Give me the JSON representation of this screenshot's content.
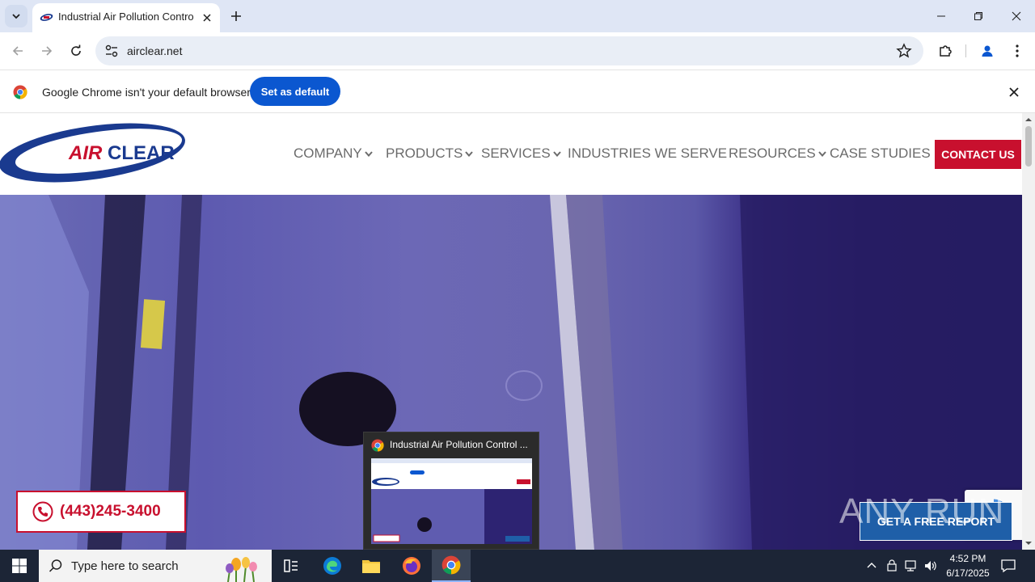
{
  "browser": {
    "tab": {
      "title": "Industrial Air Pollution Control S"
    },
    "address_bar": {
      "url": "airclear.net"
    },
    "infobar": {
      "message": "Google Chrome isn't your default browser",
      "button": "Set as default"
    }
  },
  "site": {
    "logo_text": {
      "air": "AIR",
      "clear": "CLEAR"
    },
    "nav": [
      {
        "label": "COMPANY",
        "has_dropdown": true
      },
      {
        "label": "PRODUCTS",
        "has_dropdown": true
      },
      {
        "label": "SERVICES",
        "has_dropdown": true
      },
      {
        "label": "INDUSTRIES WE SERVE",
        "has_dropdown": false
      },
      {
        "label": "RESOURCES",
        "has_dropdown": true
      },
      {
        "label": "CASE STUDIES",
        "has_dropdown": false
      }
    ],
    "contact_button": "CONTACT US",
    "phone": "(443)245-3400",
    "free_report": "GET A FREE REPORT",
    "watermark": "ANY RUN"
  },
  "taskbar": {
    "search_placeholder": "Type here to search",
    "preview_title": "Industrial Air Pollution Control ...",
    "clock": {
      "time": "4:52 PM",
      "date": "6/17/2025"
    }
  },
  "colors": {
    "brand_red": "#c8102e",
    "brand_blue": "#1a3a8f",
    "chrome_blue": "#0b57d0",
    "taskbar": "#1c2536"
  }
}
